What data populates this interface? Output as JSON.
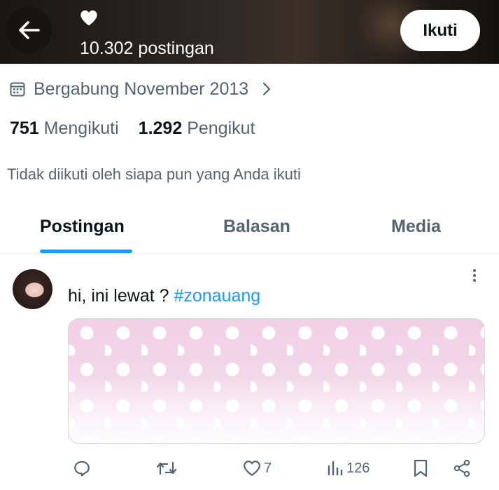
{
  "header": {
    "post_count": "10.302 postingan",
    "follow_label": "Ikuti"
  },
  "profile": {
    "joined": "Bergabung November 2013",
    "following_count": "751",
    "following_label": "Mengikuti",
    "followers_count": "1.292",
    "followers_label": "Pengikut",
    "not_followed_text": "Tidak diikuti oleh siapa pun yang Anda ikuti"
  },
  "tabs": [
    {
      "label": "Postingan",
      "active": true
    },
    {
      "label": "Balasan",
      "active": false
    },
    {
      "label": "Media",
      "active": false
    }
  ],
  "post": {
    "text": "hi, ini lewat ? ",
    "hashtag": "#zonauang",
    "actions": {
      "reply_count": "",
      "repost_count": "",
      "like_count": "7",
      "views_count": "126"
    }
  },
  "icons": {
    "back": "arrow-left-icon",
    "heart": "heart-icon",
    "calendar": "calendar-icon",
    "chevron": "chevron-right-icon",
    "more": "more-vertical-icon",
    "reply": "reply-icon",
    "repost": "repost-icon",
    "like": "like-icon",
    "views": "views-icon",
    "bookmark": "bookmark-icon",
    "share": "share-icon"
  },
  "colors": {
    "accent": "#1d9bf0",
    "text_primary": "#0f1419",
    "text_secondary": "#536471",
    "border": "#cfd9de"
  }
}
